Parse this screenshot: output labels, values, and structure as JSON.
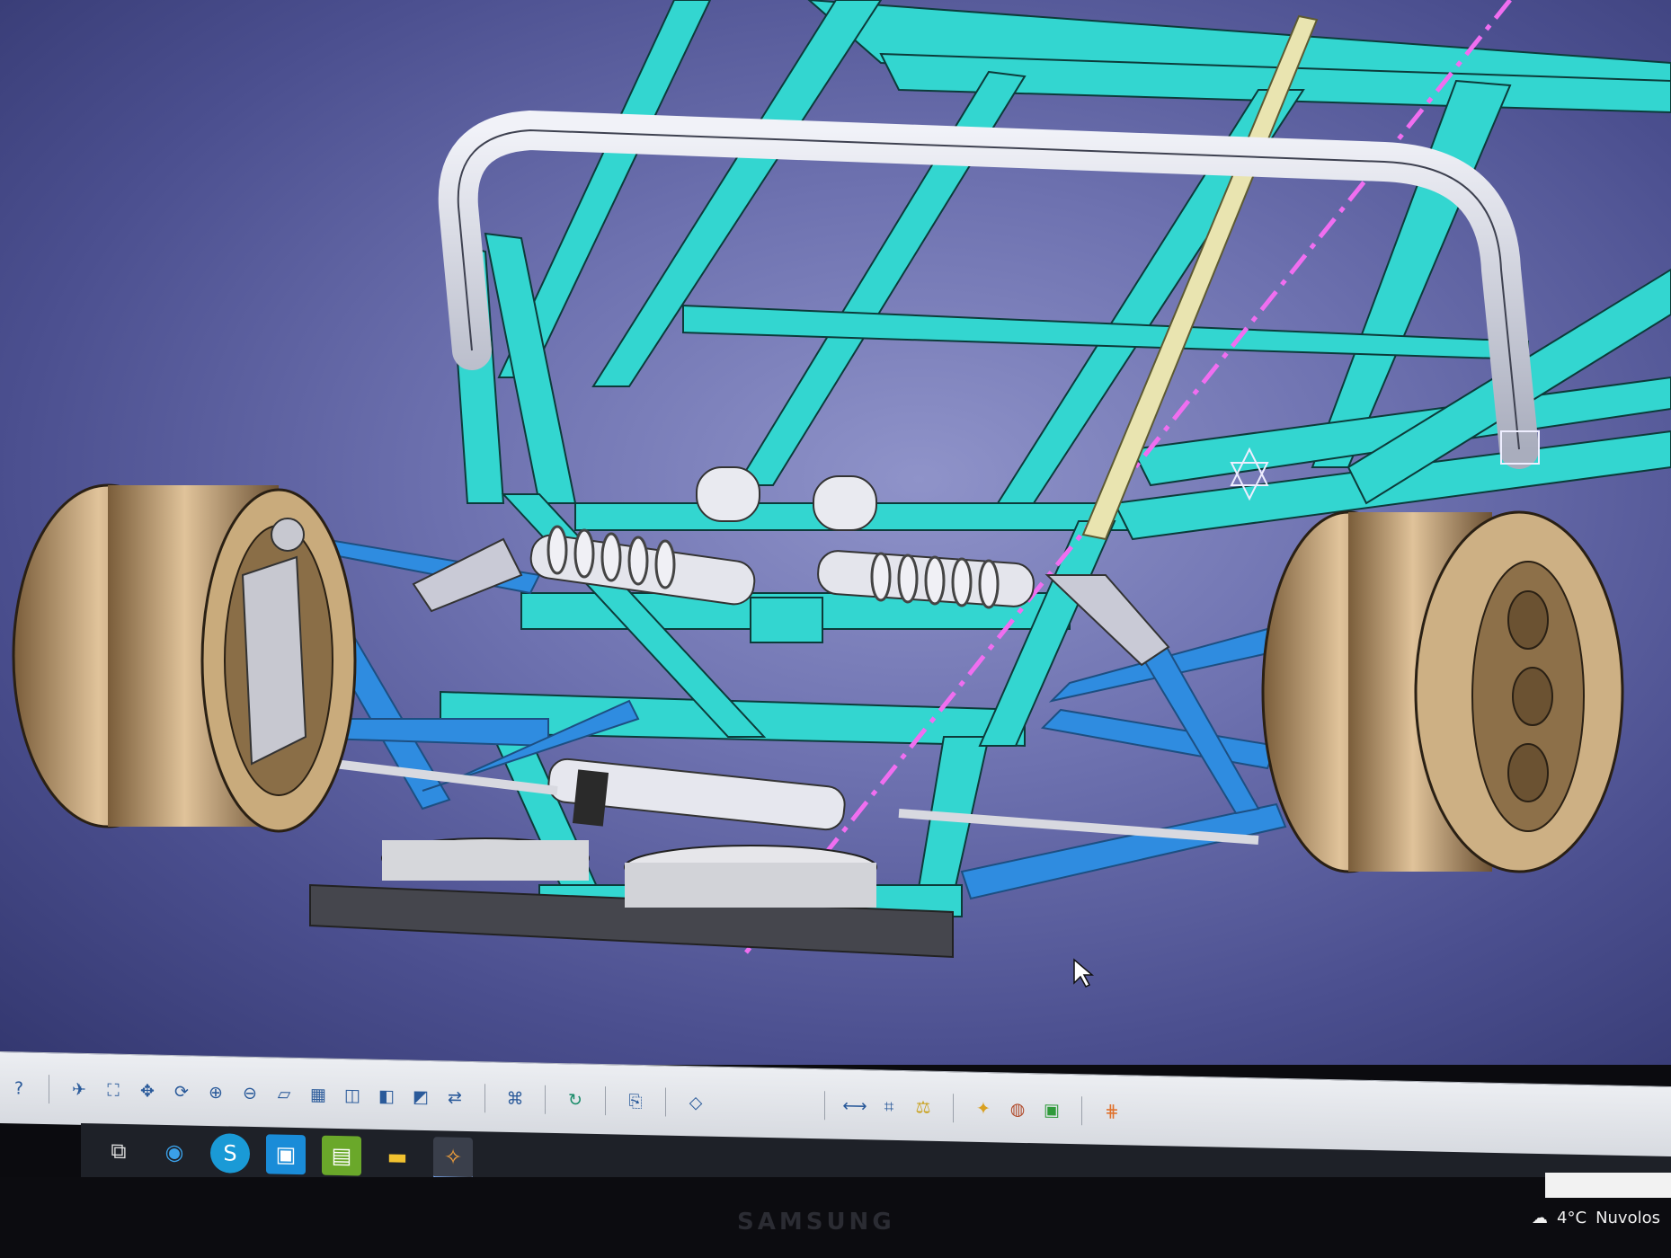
{
  "toolbar": {
    "icons": [
      "help-icon",
      "fly-mode-icon",
      "fit-all-icon",
      "pan-icon",
      "rotate-icon",
      "zoom-in-icon",
      "zoom-out-icon",
      "normal-view-icon",
      "multi-view-icon",
      "iso-view-icon",
      "shading-icon",
      "hide-show-icon",
      "swap-space-icon",
      "capture-icon",
      "refresh-icon",
      "snap-icon",
      "sketch-icon",
      "measure-icon",
      "analysis-icon",
      "weight-icon",
      "render-icon",
      "texture-icon",
      "material-icon",
      "grid-icon"
    ]
  },
  "taskbar": {
    "apps": [
      "task-view-icon",
      "edge-icon",
      "skype-icon",
      "store-icon",
      "photos-icon",
      "explorer-icon",
      "catia-icon"
    ]
  },
  "tray": {
    "temperature": "4°C",
    "weather": "Nuvolos"
  },
  "monitor": {
    "brand": "SAMSUNG"
  },
  "colors": {
    "frame": "#33d6d0",
    "frame_edge": "#0c3b3a",
    "wishbone": "#2f8ce0",
    "rim": "#b89668",
    "rollbar": "#c9ccd8",
    "axis_line": "#f06ef0"
  }
}
